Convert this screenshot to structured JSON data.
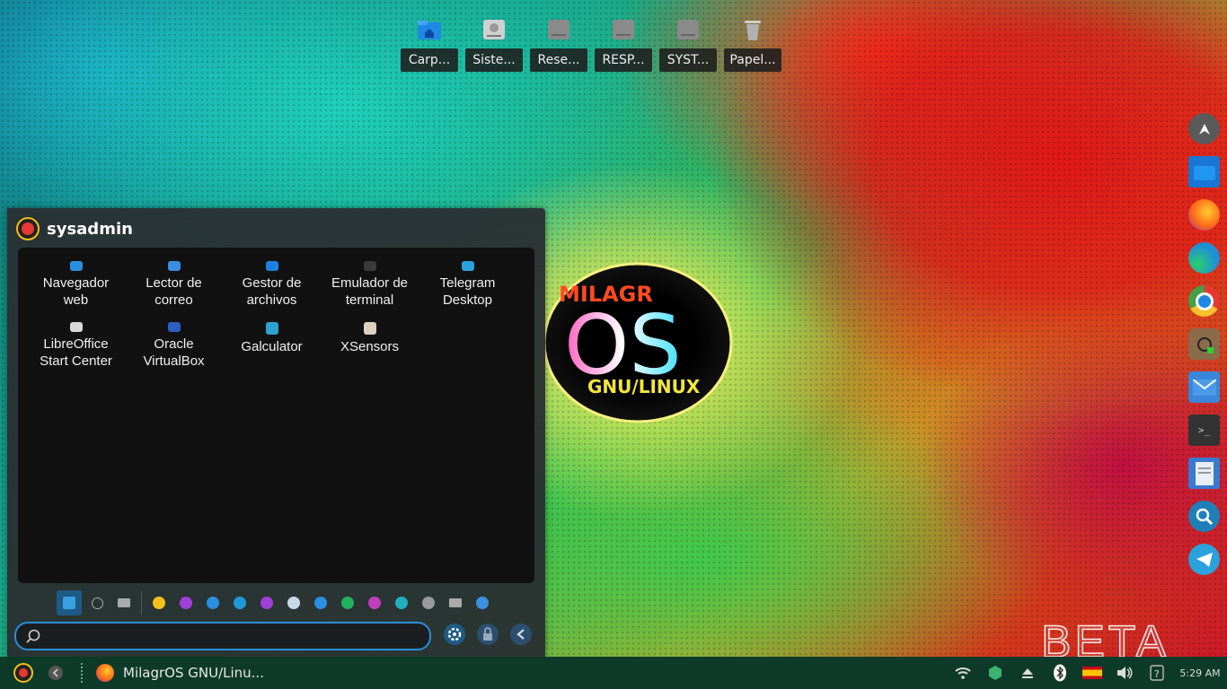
{
  "desktop": {
    "icons": [
      {
        "label": "Carp...",
        "icon": "home-folder-icon",
        "color": "#1e88e5"
      },
      {
        "label": "Siste...",
        "icon": "drive-icon",
        "color": "#d0d0d0"
      },
      {
        "label": "Rese...",
        "icon": "drive-icon",
        "color": "#888888"
      },
      {
        "label": "RESP...",
        "icon": "drive-icon",
        "color": "#888888"
      },
      {
        "label": "SYST...",
        "icon": "drive-icon",
        "color": "#888888"
      },
      {
        "label": "Papel...",
        "icon": "trash-icon",
        "color": "#bbbbbb"
      }
    ],
    "logo": {
      "line1": "MILAGR",
      "line2": "OS",
      "line3": "GNU/LINUX"
    },
    "watermark": "BETA"
  },
  "dock": [
    {
      "name": "launcher-rocket-icon",
      "color": "#5a5a5a"
    },
    {
      "name": "files-folder-icon",
      "color": "#1976d2"
    },
    {
      "name": "firefox-icon",
      "color": "#ff7a18"
    },
    {
      "name": "edge-icon",
      "color": "#1f8fd6"
    },
    {
      "name": "chrome-icon",
      "color": "#e8e8e8"
    },
    {
      "name": "downloader-icon",
      "color": "#8a6b4a"
    },
    {
      "name": "mail-icon",
      "color": "#3a86d8"
    },
    {
      "name": "terminal-icon",
      "color": "#333333"
    },
    {
      "name": "document-viewer-icon",
      "color": "#3a7ad0"
    },
    {
      "name": "search-icon",
      "color": "#1f7fb8"
    },
    {
      "name": "telegram-icon",
      "color": "#2aa2dc"
    }
  ],
  "launcher": {
    "user": "sysadmin",
    "apps": [
      {
        "label": "Navegador\nweb",
        "icon": "web-browser-icon",
        "color": "#2a8fe0"
      },
      {
        "label": "Lector de\ncorreo",
        "icon": "mail-reader-icon",
        "color": "#3a8de0"
      },
      {
        "label": "Gestor de\narchivos",
        "icon": "file-manager-icon",
        "color": "#1e7fe0"
      },
      {
        "label": "Emulador de\nterminal",
        "icon": "terminal-icon",
        "color": "#3a3a3a"
      },
      {
        "label": "Telegram\nDesktop",
        "icon": "telegram-icon",
        "color": "#2aa2dc"
      },
      {
        "label": "LibreOffice\nStart Center",
        "icon": "libreoffice-icon",
        "color": "#d8d8d8"
      },
      {
        "label": "Oracle\nVirtualBox",
        "icon": "virtualbox-icon",
        "color": "#2d5fc0"
      },
      {
        "label": "Galculator",
        "icon": "calculator-icon",
        "color": "#30a0d0"
      },
      {
        "label": "XSensors",
        "icon": "sensors-icon",
        "color": "#e0d0c0"
      }
    ],
    "categories": [
      {
        "name": "favorites-icon",
        "color": "#3aa0e0",
        "selected": true
      },
      {
        "name": "recent-icon",
        "color": "#aaaaaa"
      },
      {
        "name": "all-apps-icon",
        "color": "#aaaaaa"
      },
      {
        "name": "accessories-icon",
        "color": "#f2c01a"
      },
      {
        "name": "development-icon",
        "color": "#a040d8"
      },
      {
        "name": "education-icon",
        "color": "#2a8fe0"
      },
      {
        "name": "graphics-icon",
        "color": "#1f9ad8"
      },
      {
        "name": "internet-icon",
        "color": "#a040d8"
      },
      {
        "name": "settings-icon",
        "color": "#c8d8e8"
      },
      {
        "name": "network-icon",
        "color": "#2a8fe0"
      },
      {
        "name": "office-icon",
        "color": "#20b060"
      },
      {
        "name": "multimedia-icon",
        "color": "#c040c0"
      },
      {
        "name": "science-icon",
        "color": "#20b0c0"
      },
      {
        "name": "system-icon",
        "color": "#999999"
      },
      {
        "name": "other-icon",
        "color": "#aaaaaa"
      },
      {
        "name": "preferences-icon",
        "color": "#3a8fe0"
      }
    ],
    "search_placeholder": ""
  },
  "taskbar": {
    "window_title": "MilagrOS GNU/Linu...",
    "time": "5:29 AM"
  }
}
